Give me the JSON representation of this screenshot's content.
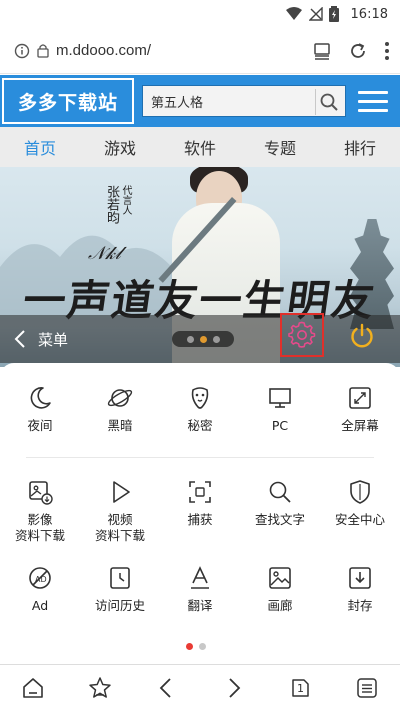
{
  "status_bar": {
    "time": "16:18"
  },
  "address_bar": {
    "url": "m.ddooo.com/"
  },
  "site_header": {
    "logo": "多多下载站",
    "search_value": "第五人格"
  },
  "nav": {
    "items": [
      "首页",
      "游戏",
      "软件",
      "专题",
      "排行"
    ],
    "active_index": 0
  },
  "banner": {
    "calligraphy": "一声道友一生明友",
    "vertical_small": "代言人",
    "vertical_name": "张若昀"
  },
  "menu": {
    "back_label": "菜单",
    "rows": [
      [
        {
          "label": "夜间",
          "icon": "moon-icon"
        },
        {
          "label": "黑暗",
          "icon": "planet-icon"
        },
        {
          "label": "秘密",
          "icon": "mask-icon"
        },
        {
          "label": "PC",
          "icon": "monitor-icon"
        },
        {
          "label": "全屏幕",
          "icon": "fullscreen-icon"
        }
      ],
      [
        {
          "label": "影像",
          "label2": "资料下载",
          "icon": "image-download-icon"
        },
        {
          "label": "视频",
          "label2": "资料下载",
          "icon": "video-play-icon"
        },
        {
          "label": "捕获",
          "icon": "capture-icon"
        },
        {
          "label": "查找文字",
          "icon": "search-icon"
        },
        {
          "label": "安全中心",
          "icon": "shield-icon"
        }
      ],
      [
        {
          "label": "Ad",
          "icon": "ad-block-icon"
        },
        {
          "label": "访问历史",
          "icon": "history-icon"
        },
        {
          "label": "翻译",
          "icon": "translate-icon"
        },
        {
          "label": "画廊",
          "icon": "gallery-icon"
        },
        {
          "label": "封存",
          "icon": "archive-icon"
        }
      ]
    ],
    "page_count": 2,
    "active_page": 0
  },
  "colors": {
    "brand_blue": "#2a8ddc",
    "highlight_red": "#e0302b",
    "power_yellow": "#f2b01e",
    "settings_pink": "#e64a8b"
  },
  "bottom_bar": {
    "icons": [
      "home-icon",
      "bookmark-star-icon",
      "back-arrow-icon",
      "forward-arrow-icon",
      "tabs-icon",
      "menu-list-icon"
    ],
    "tab_count": "1"
  }
}
